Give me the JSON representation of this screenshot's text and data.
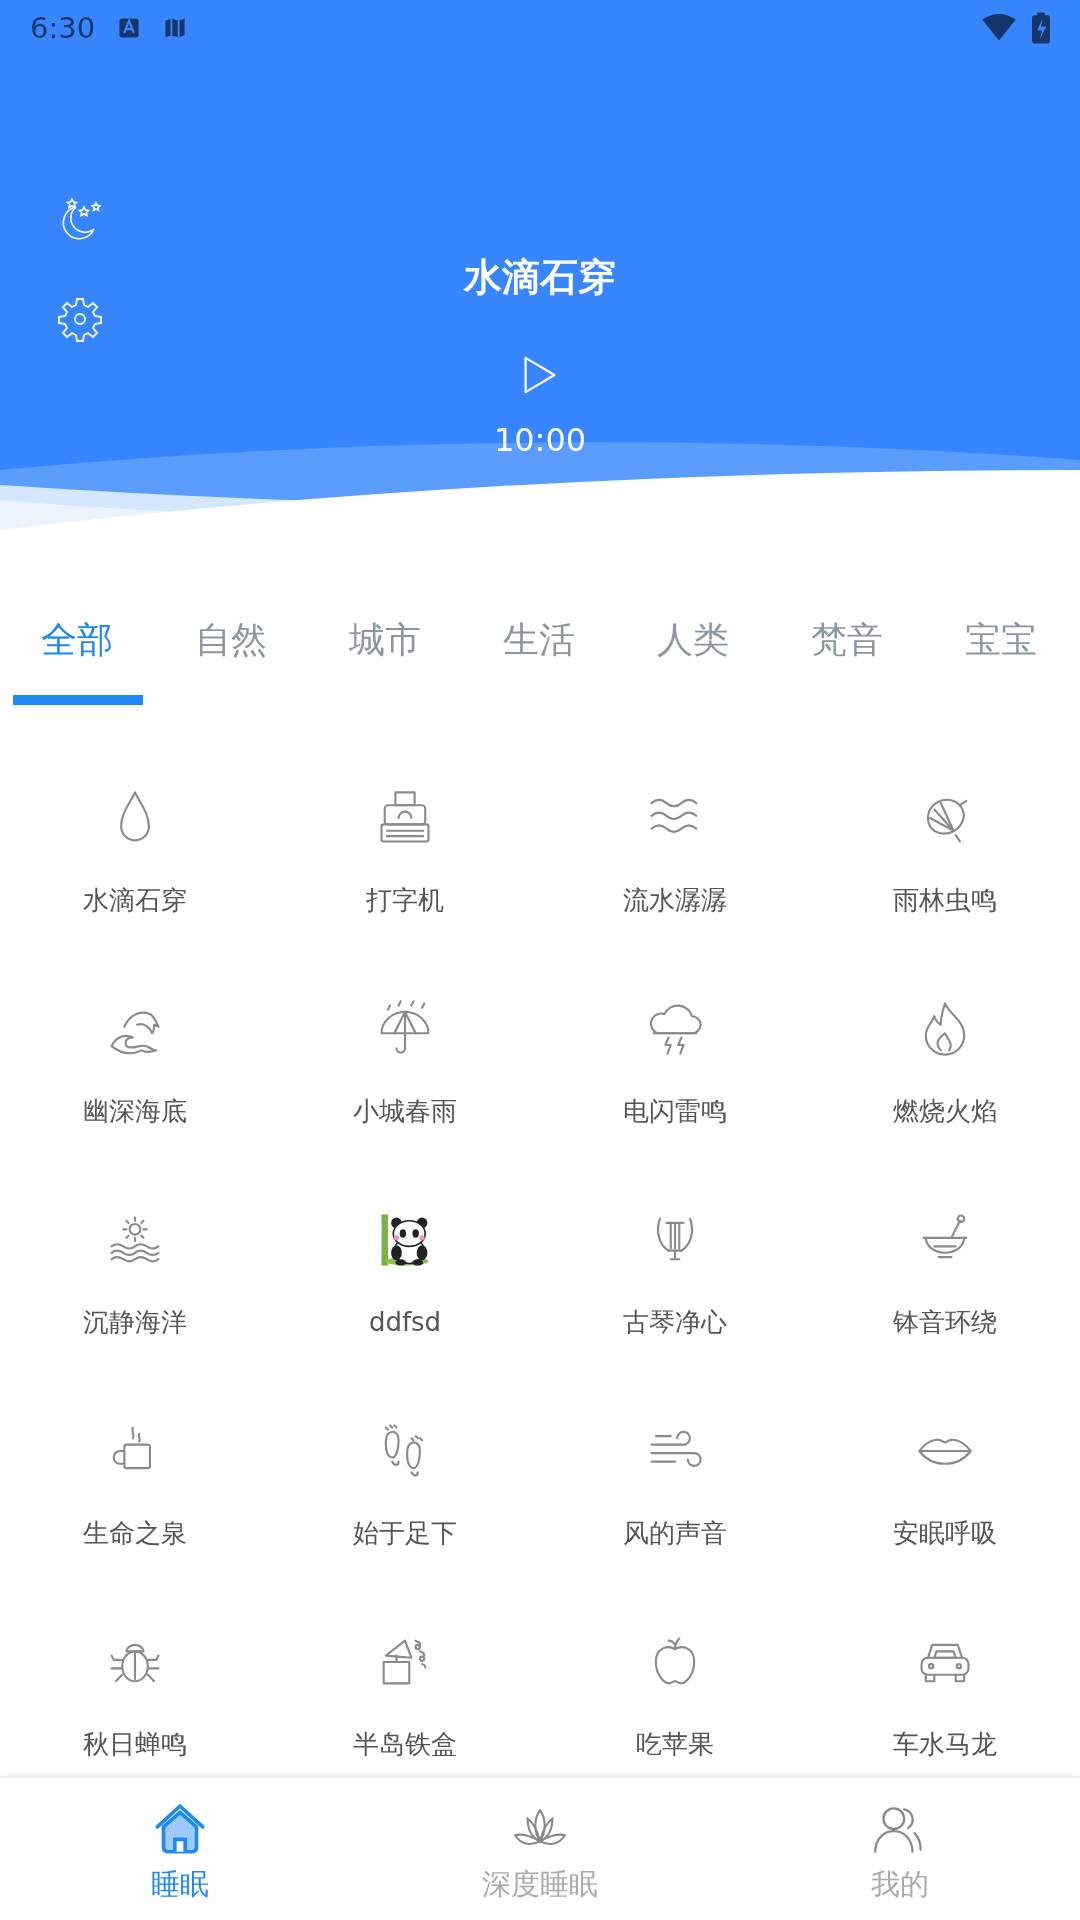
{
  "status_bar": {
    "time": "6:30"
  },
  "header": {
    "title": "水滴石穿",
    "timer": "10:00"
  },
  "tabs": [
    {
      "label": "全部",
      "selected": true
    },
    {
      "label": "自然",
      "selected": false
    },
    {
      "label": "城市",
      "selected": false
    },
    {
      "label": "生活",
      "selected": false
    },
    {
      "label": "人类",
      "selected": false
    },
    {
      "label": "梵音",
      "selected": false
    },
    {
      "label": "宝宝",
      "selected": false
    }
  ],
  "sounds": [
    {
      "label": "水滴石穿"
    },
    {
      "label": "打字机"
    },
    {
      "label": "流水潺潺"
    },
    {
      "label": "雨林虫鸣"
    },
    {
      "label": "幽深海底"
    },
    {
      "label": "小城春雨"
    },
    {
      "label": "电闪雷鸣"
    },
    {
      "label": "燃烧火焰"
    },
    {
      "label": "沉静海洋"
    },
    {
      "label": "ddfsd"
    },
    {
      "label": "古琴净心"
    },
    {
      "label": "钵音环绕"
    },
    {
      "label": "生命之泉"
    },
    {
      "label": "始于足下"
    },
    {
      "label": "风的声音"
    },
    {
      "label": "安眠呼吸"
    },
    {
      "label": "秋日蝉鸣"
    },
    {
      "label": "半岛铁盒"
    },
    {
      "label": "吃苹果"
    },
    {
      "label": "车水马龙"
    }
  ],
  "bottom_nav": [
    {
      "label": "睡眠",
      "selected": true
    },
    {
      "label": "深度睡眠",
      "selected": false
    },
    {
      "label": "我的",
      "selected": false
    }
  ]
}
